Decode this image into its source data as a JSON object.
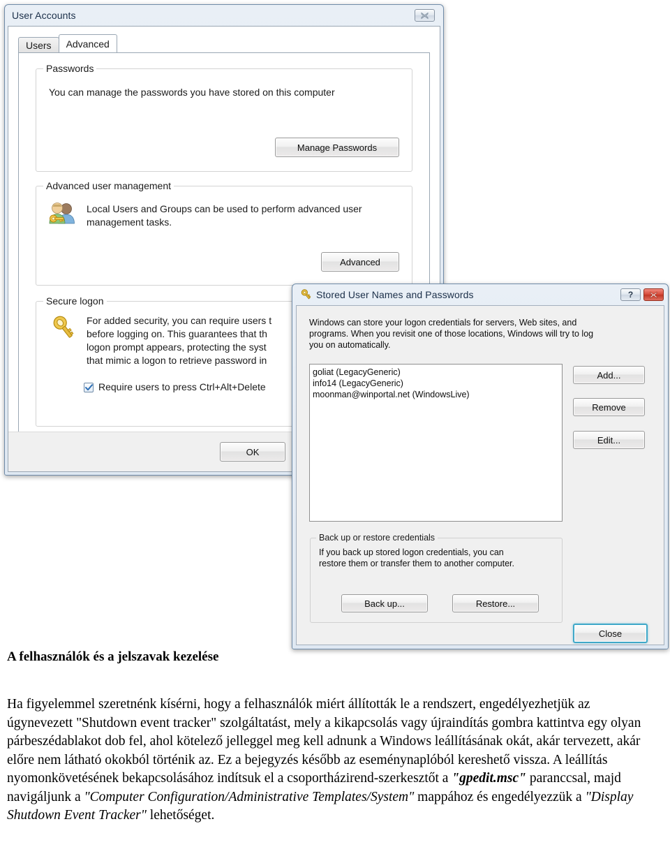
{
  "user_accounts_window": {
    "title": "User Accounts",
    "close_glyph": "✖",
    "tabs": [
      {
        "label": "Users",
        "active": false
      },
      {
        "label": "Advanced",
        "active": true
      }
    ],
    "passwords_group": {
      "title": "Passwords",
      "description": "You can manage the passwords you have stored on this computer",
      "button": "Manage Passwords"
    },
    "advanced_group": {
      "title": "Advanced user management",
      "description_line1": "Local Users and Groups can be used to perform advanced user",
      "description_line2": "management tasks.",
      "icon": "users-key-icon",
      "button": "Advanced"
    },
    "secure_logon_group": {
      "title": "Secure logon",
      "icon": "gold-key-icon",
      "description_line1": "For added security, you can require users t",
      "description_line2": "before logging on. This guarantees that th",
      "description_line3": "logon prompt appears, protecting the syst",
      "description_line4": "that mimic a logon to retrieve password in",
      "checkbox_label": "Require users to press Ctrl+Alt+Delete",
      "checkbox_checked": true
    },
    "footer": {
      "ok_button": "OK"
    }
  },
  "stored_dialog": {
    "title": "Stored User Names and Passwords",
    "title_icon": "gold-key-icon",
    "help_button_glyph": "?",
    "close_button_glyph": "✖",
    "intro_line1": "Windows can store your logon credentials for servers, Web sites, and",
    "intro_line2": "programs. When you revisit one of those locations, Windows will try to log",
    "intro_line3": "you on automatically.",
    "credentials": [
      "goliat (LegacyGeneric)",
      "info14 (LegacyGeneric)",
      "moonman@winportal.net (WindowsLive)"
    ],
    "side_buttons": [
      {
        "label": "Add..."
      },
      {
        "label": "Remove"
      },
      {
        "label": "Edit..."
      }
    ],
    "backup_group": {
      "title": "Back up or restore credentials",
      "description_line1": "If you back up stored logon credentials, you can",
      "description_line2": "restore them or transfer them to another computer.",
      "backup_button": "Back up...",
      "restore_button": "Restore..."
    },
    "close_label": "Close"
  },
  "document": {
    "heading": "A felhasználók és a jelszavak kezelése",
    "paragraph_part1": "Ha figyelemmel szeretnénk kísérni, hogy a felhasználók miért állították le a rendszert, engedélyezhetjük az úgynevezett \"Shutdown event tracker\" szolgáltatást, mely a kikapcsolás vagy újraindítás gombra kattintva egy olyan párbeszédablakot dob fel, ahol kötelező jelleggel meg kell adnunk a Windows leállításának okát, akár tervezett, akár előre nem látható okokból történik az. Ez a bejegyzés később az eseménynaplóból kereshető vissza. A leállítás nyomonkövetésének bekapcsolásához indítsuk el a csoportházirend-szerkesztőt a ",
    "gpedit": "\"gpedit.msc\"",
    "paragraph_part2": " paranccsal, majd navigáljunk a ",
    "path": "\"Computer Configuration/Administrative Templates/System\"",
    "paragraph_part3": " mappához és engedélyezzük a ",
    "option": "\"Display Shutdown Event Tracker\"",
    "paragraph_part4": " lehetőséget."
  }
}
